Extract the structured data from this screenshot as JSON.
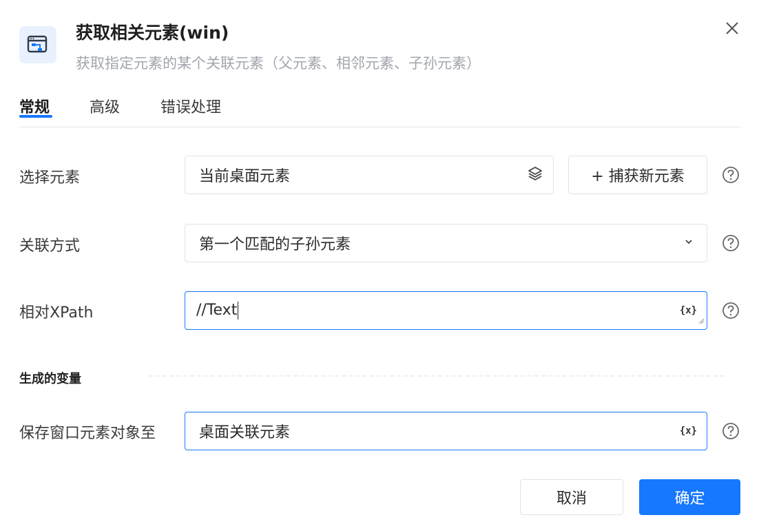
{
  "header": {
    "title": "获取相关元素(win)",
    "subtitle": "获取指定元素的某个关联元素（父元素、相邻元素、子孙元素）",
    "icon": "window-element-icon",
    "close_icon": "close-icon"
  },
  "tabs": [
    {
      "label": "常规",
      "active": true
    },
    {
      "label": "高级",
      "active": false
    },
    {
      "label": "错误处理",
      "active": false
    }
  ],
  "form": {
    "select_element": {
      "label": "选择元素",
      "value": "当前桌面元素",
      "icon": "layers-icon",
      "capture_button": "+ 捕获新元素"
    },
    "relation": {
      "label": "关联方式",
      "value": "第一个匹配的子孙元素",
      "icon": "chevron-down-icon"
    },
    "xpath": {
      "label": "相对XPath",
      "value": "//Text",
      "variable_token": "{x}"
    }
  },
  "output_section": {
    "title": "生成的变量",
    "save_to": {
      "label": "保存窗口元素对象至",
      "value": "桌面关联元素",
      "variable_token": "{x}"
    }
  },
  "footer": {
    "cancel_label": "取消",
    "ok_label": "确定"
  },
  "colors": {
    "accent": "#1677ff",
    "subtitle": "#a2a6ad",
    "border": "#dfe2e6"
  }
}
